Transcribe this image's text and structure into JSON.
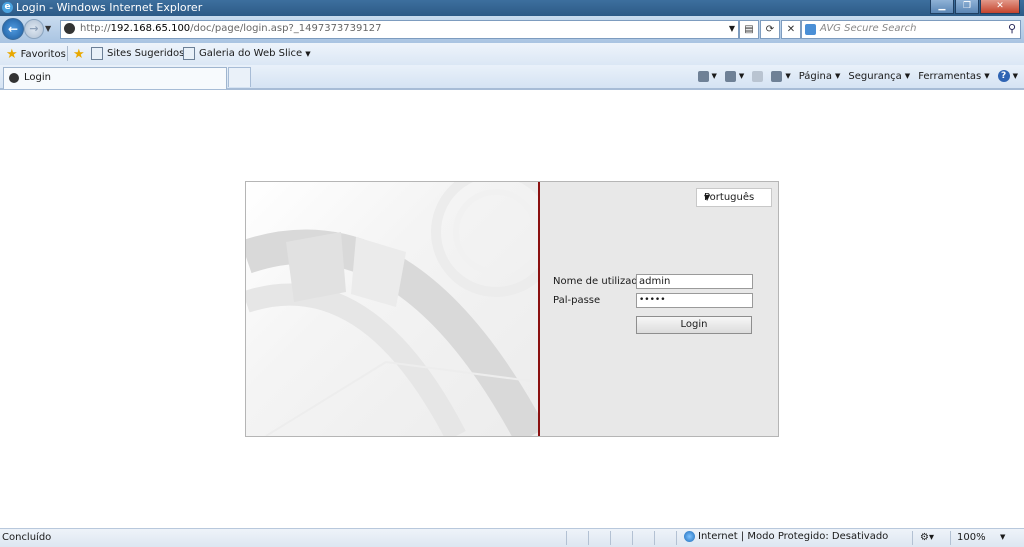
{
  "window": {
    "title": "Login - Windows Internet Explorer"
  },
  "address": {
    "url_prefix": "http://",
    "url_host": "192.168.65.100",
    "url_path": "/doc/page/login.asp?_1497373739127"
  },
  "search": {
    "placeholder": "AVG Secure Search"
  },
  "favorites": {
    "favorites_label": "Favoritos",
    "sites_label": "Sites Sugeridos",
    "gallery_label": "Galeria do Web Slice"
  },
  "tab": {
    "label": "Login"
  },
  "command_bar": {
    "page_label": "Página",
    "security_label": "Segurança",
    "tools_label": "Ferramentas"
  },
  "login": {
    "language": "Português",
    "username_label": "Nome de utilizador",
    "username_value": "admin",
    "password_label": "Pal-passe",
    "password_value": "•••••",
    "login_button": "Login"
  },
  "status_bar": {
    "status": "Concluído",
    "zone": "Internet | Modo Protegido: Desativado",
    "zoom": "100%"
  },
  "colors": {
    "divider": "#8a1010",
    "panel_bg": "#e8e8e8"
  }
}
